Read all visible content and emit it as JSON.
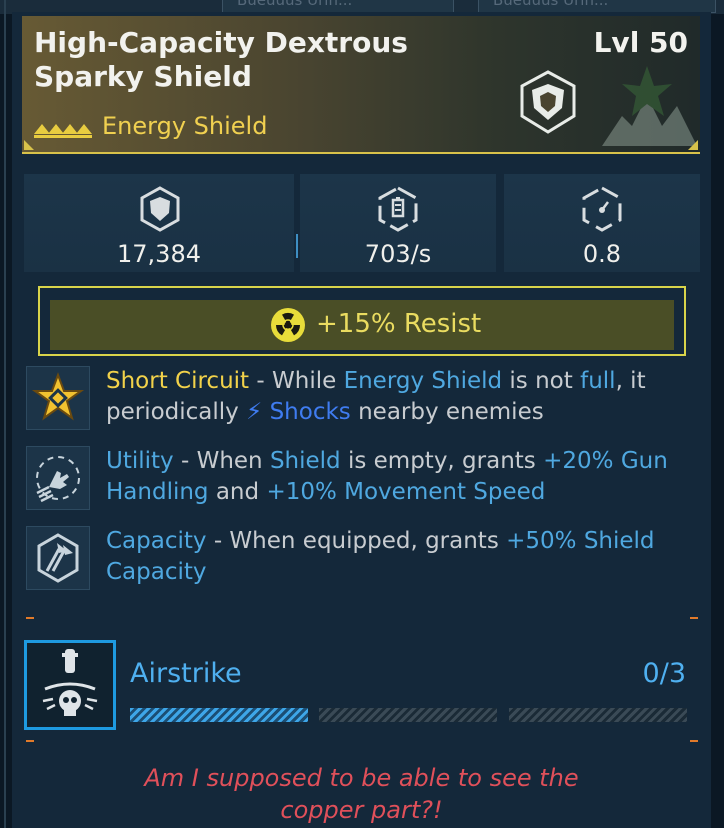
{
  "header": {
    "title": "High-Capacity Dextrous Sparky Shield",
    "level": "Lvl 50",
    "type": "Energy Shield",
    "accent": "#d8c24a"
  },
  "stats": [
    {
      "icon": "shield-capacity-icon",
      "value": "17,384"
    },
    {
      "icon": "shield-recharge-rate-icon",
      "value": "703/s"
    },
    {
      "icon": "shield-recharge-delay-icon",
      "value": "0.8"
    }
  ],
  "resist": {
    "icon": "radiation-icon",
    "text": "+15% Resist",
    "color": "#eadc60"
  },
  "perks": [
    {
      "icon": "star-badge-icon",
      "segments": [
        {
          "t": "Short Circuit",
          "c": "name-yellow"
        },
        {
          "t": " - While ",
          "c": ""
        },
        {
          "t": "Energy Shield",
          "c": "hl"
        },
        {
          "t": " is not ",
          "c": ""
        },
        {
          "t": "full",
          "c": "hl"
        },
        {
          "t": ", it periodically ",
          "c": ""
        },
        {
          "t": "⚡ Shocks",
          "c": "shock"
        },
        {
          "t": " nearby enemies",
          "c": ""
        }
      ]
    },
    {
      "icon": "hand-movement-icon",
      "segments": [
        {
          "t": "Utility",
          "c": "name-blue"
        },
        {
          "t": " - When ",
          "c": ""
        },
        {
          "t": "Shield",
          "c": "hl"
        },
        {
          "t": " is empty, grants ",
          "c": ""
        },
        {
          "t": "+20% Gun Handling",
          "c": "hl"
        },
        {
          "t": " and ",
          "c": ""
        },
        {
          "t": "+10% Movement Speed",
          "c": "hl"
        }
      ]
    },
    {
      "icon": "shield-arrows-icon",
      "segments": [
        {
          "t": "Capacity",
          "c": "name-blue"
        },
        {
          "t": " - When equipped, grants ",
          "c": ""
        },
        {
          "t": "+50% Shield Capacity",
          "c": "hl"
        }
      ]
    }
  ],
  "airstrike": {
    "icon": "airstrike-skull-icon",
    "name": "Airstrike",
    "count": "0/3",
    "bars_filled": 1,
    "bars_total": 3
  },
  "flavor": "Am I supposed to be able to see the copper part?!",
  "background_tabs": [
    "Bueuuus Urin...",
    "Bueuuus Urin..."
  ]
}
